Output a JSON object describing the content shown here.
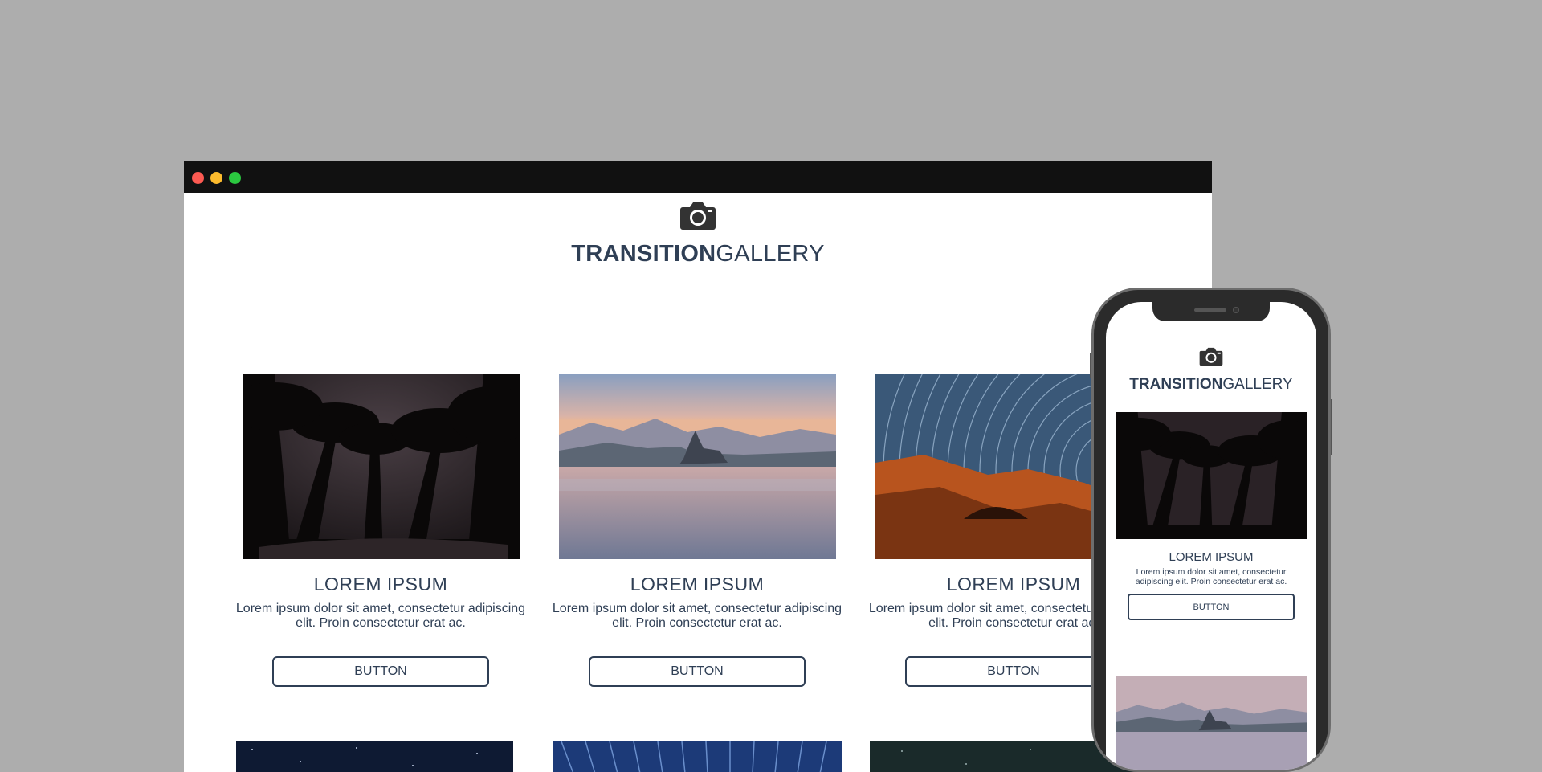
{
  "brand": {
    "bold": "TRANSITION",
    "light": "GALLERY"
  },
  "window": {
    "controls": [
      "close",
      "minimize",
      "maximize"
    ]
  },
  "cards": [
    {
      "title": "LOREM IPSUM",
      "text": "Lorem ipsum dolor sit amet, consectetur adipiscing elit. Proin consectetur erat ac.",
      "button": "BUTTON",
      "image": "palm-trees-night"
    },
    {
      "title": "LOREM IPSUM",
      "text": "Lorem ipsum dolor sit amet, consectetur adipiscing elit. Proin consectetur erat ac.",
      "button": "BUTTON",
      "image": "lake-island-church"
    },
    {
      "title": "LOREM IPSUM",
      "text": "Lorem ipsum dolor sit amet, consectetur adipiscing elit. Proin consectetur erat ac.",
      "button": "BUTTON",
      "image": "star-trails-canyon"
    }
  ],
  "mobile": {
    "card": {
      "title": "LOREM IPSUM",
      "text": "Lorem ipsum dolor sit amet, consectetur adipiscing elit. Proin consectetur erat ac.",
      "button": "BUTTON"
    }
  },
  "icons": {
    "logo": "camera-icon"
  }
}
